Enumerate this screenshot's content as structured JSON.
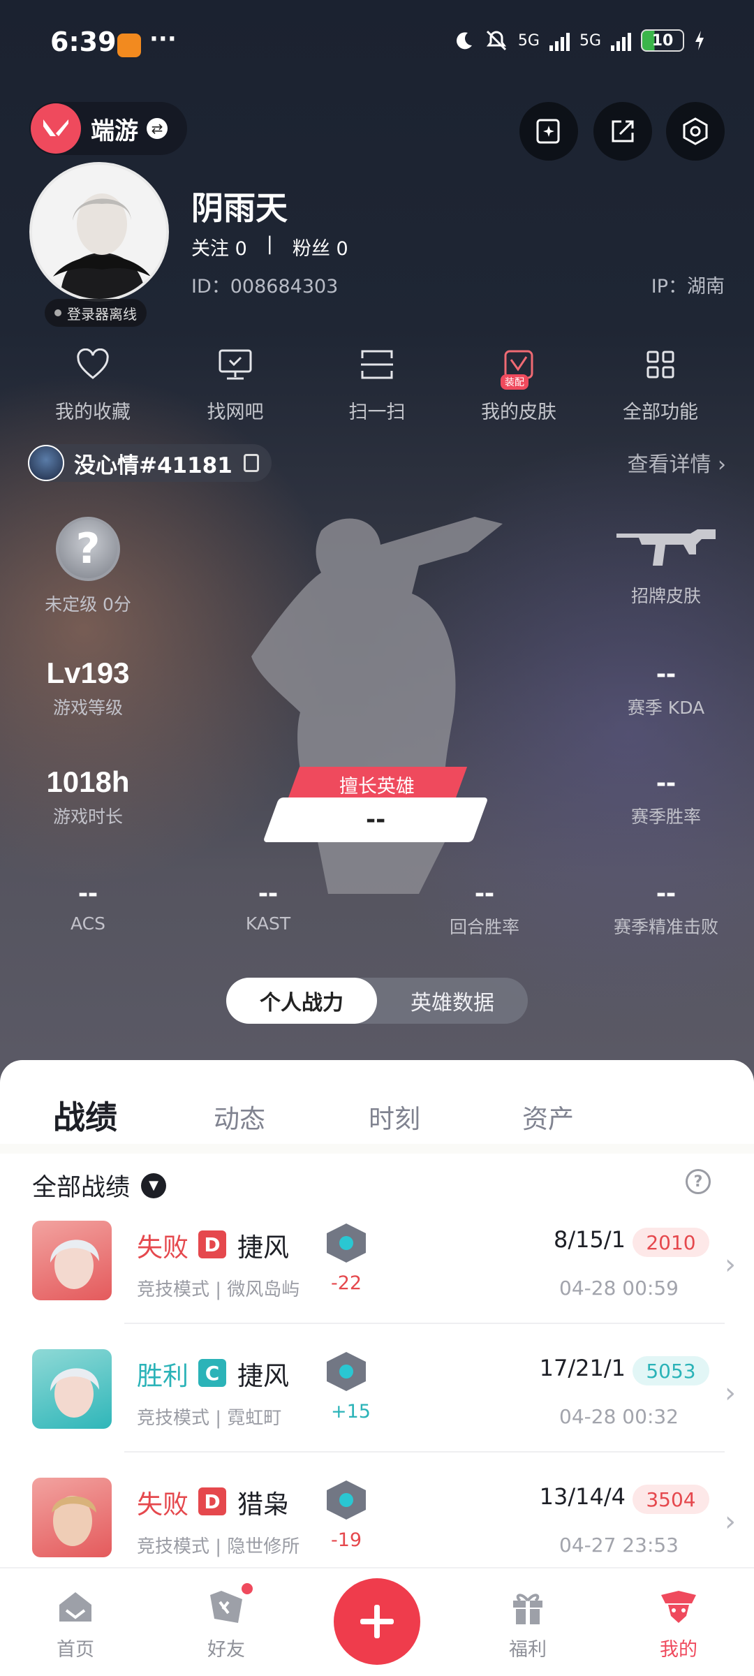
{
  "status_bar": {
    "time": "6:39",
    "dots": "···",
    "network_1": "5G",
    "network_2": "5G",
    "battery": "10"
  },
  "header": {
    "switch_label": "端游"
  },
  "profile": {
    "nickname": "阴雨天",
    "follow_label": "关注 0",
    "fans_label": "粉丝 0",
    "divider": "|",
    "id_text": "ID：008684303",
    "ip_text": "IP：湖南",
    "offline_label": "登录器离线"
  },
  "quick_actions": [
    {
      "label": "我的收藏",
      "icon": "heart-icon"
    },
    {
      "label": "找网吧",
      "icon": "monitor-icon"
    },
    {
      "label": "扫一扫",
      "icon": "scan-icon"
    },
    {
      "label": "我的皮肤",
      "icon": "skin-icon",
      "badge": "装配"
    },
    {
      "label": "全部功能",
      "icon": "grid-icon"
    }
  ],
  "account": {
    "name": "没心情#41181",
    "details_link": "查看详情"
  },
  "stats": {
    "rank": {
      "icon_glyph": "?",
      "label": "未定级 0分"
    },
    "showcase_skin": {
      "label": "招牌皮肤"
    },
    "level": {
      "value": "Lv193",
      "label": "游戏等级"
    },
    "kda": {
      "value": "--",
      "label": "赛季 KDA"
    },
    "playtime": {
      "value": "1018h",
      "label": "游戏时长"
    },
    "winrate": {
      "value": "--",
      "label": "赛季胜率"
    },
    "main_hero": {
      "tag": "擅长英雄",
      "value": "--"
    },
    "bottom_row": [
      {
        "value": "--",
        "label": "ACS"
      },
      {
        "value": "--",
        "label": "KAST"
      },
      {
        "value": "--",
        "label": "回合胜率"
      },
      {
        "value": "--",
        "label": "赛季精准击败"
      }
    ]
  },
  "toggle": {
    "active": "个人战力",
    "inactive": "英雄数据"
  },
  "tabs": [
    "战绩",
    "动态",
    "时刻",
    "资产"
  ],
  "filter": {
    "label": "全部战绩",
    "help_glyph": "?"
  },
  "matches": [
    {
      "result": "失败",
      "grade": "D",
      "agent": "捷风",
      "mode": "竞技模式 | 微风岛屿",
      "delta": "-22",
      "kda": "8/15/1",
      "score": "2010",
      "date": "04-28 00:59",
      "result_color": "#e5484d",
      "grade_color": "#e5484d",
      "agent_color": "#e86a6e"
    },
    {
      "result": "胜利",
      "grade": "C",
      "agent": "捷风",
      "mode": "竞技模式 | 霓虹町",
      "delta": "+15",
      "kda": "17/21/1",
      "score": "5053",
      "date": "04-28 00:32",
      "result_color": "#2bb3b8",
      "grade_color": "#2bb3b8",
      "agent_color": "#3fb6c0"
    },
    {
      "result": "失败",
      "grade": "D",
      "agent": "猎枭",
      "mode": "竞技模式 | 隐世修所",
      "delta": "-19",
      "kda": "13/14/4",
      "score": "3504",
      "date": "04-27 23:53",
      "result_color": "#e5484d",
      "grade_color": "#e5484d",
      "agent_color": "#e86a6e"
    }
  ],
  "bottom_nav": [
    {
      "label": "首页",
      "icon": "home-icon"
    },
    {
      "label": "好友",
      "icon": "friends-icon"
    },
    {
      "label": "福利",
      "icon": "gift-icon"
    },
    {
      "label": "我的",
      "icon": "profile-icon"
    }
  ],
  "colors": {
    "accent": "#ef4a5d",
    "win": "#2bb3b8",
    "loss": "#e5484d"
  }
}
